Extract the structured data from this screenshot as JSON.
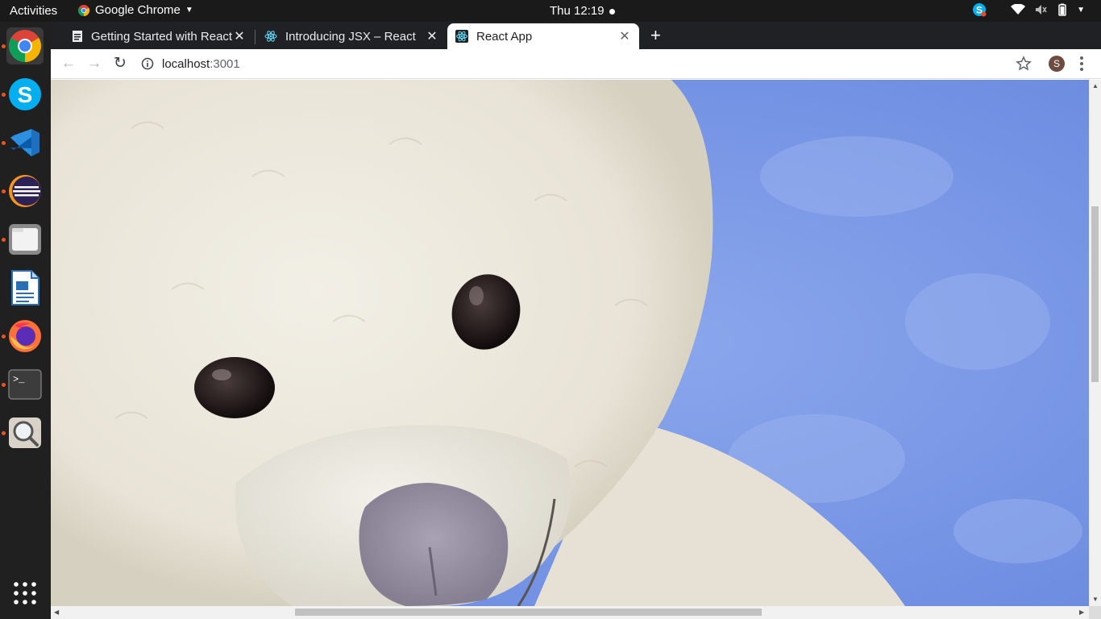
{
  "topbar": {
    "activities": "Activities",
    "app_name": "Google Chrome",
    "clock": "Thu 12:19",
    "tray_icons": [
      "skype-tray-icon",
      "wifi-icon",
      "volume-icon",
      "battery-icon",
      "power-menu-icon"
    ]
  },
  "dock": {
    "apps": [
      {
        "name": "chrome",
        "running": true
      },
      {
        "name": "skype",
        "running": true
      },
      {
        "name": "vscode",
        "running": true
      },
      {
        "name": "eclipse",
        "running": true
      },
      {
        "name": "files",
        "running": true
      },
      {
        "name": "libreoffice-writer",
        "running": false
      },
      {
        "name": "firefox",
        "running": true
      },
      {
        "name": "terminal",
        "running": true
      },
      {
        "name": "image-viewer",
        "running": true
      }
    ],
    "show_apps": "apps-grid-icon"
  },
  "browser": {
    "tabs": [
      {
        "title": "Getting Started with React",
        "icon": "page-icon",
        "active": false
      },
      {
        "title": "Introducing JSX – React",
        "icon": "react-icon",
        "active": false
      },
      {
        "title": "React App",
        "icon": "react-icon",
        "active": true
      }
    ],
    "url_host": "localhost",
    "url_port": ":3001",
    "avatar_letter": "S"
  },
  "page": {
    "image": "teddy-bear-photo",
    "colors": {
      "sky": "#7b9be8",
      "fur": "#ece8dc",
      "nose": "#9a94a6"
    }
  },
  "scroll": {
    "vertical_fraction": 0.24,
    "horizontal_fraction": 0.24
  }
}
